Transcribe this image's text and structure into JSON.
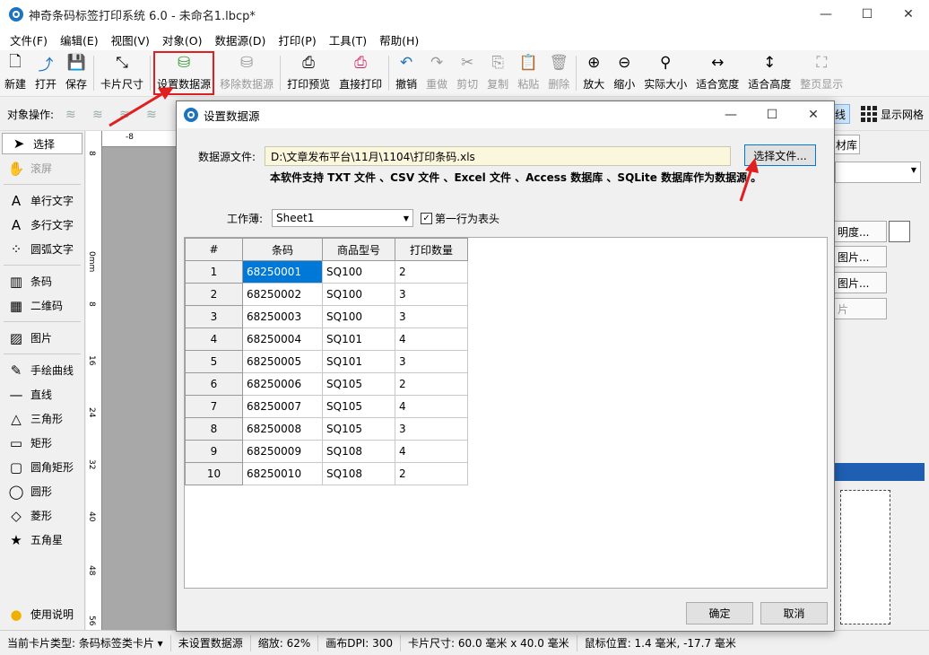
{
  "window": {
    "title": "神奇条码标签打印系统 6.0 - 未命名1.lbcp*",
    "controls": [
      "—",
      "☐",
      "✕"
    ]
  },
  "menu": [
    "文件(F)",
    "编辑(E)",
    "视图(V)",
    "对象(O)",
    "数据源(D)",
    "打印(P)",
    "工具(T)",
    "帮助(H)"
  ],
  "toolbar": [
    {
      "label": "新建",
      "icon": "new-file-icon",
      "glyph": "🗋"
    },
    {
      "label": "打开",
      "icon": "open-icon",
      "glyph": "⤴"
    },
    {
      "label": "保存",
      "icon": "save-icon",
      "glyph": "💾"
    },
    {
      "label": "卡片尺寸",
      "icon": "card-size-icon",
      "glyph": "⤡"
    },
    {
      "label": "设置数据源",
      "icon": "database-icon",
      "glyph": "⛁"
    },
    {
      "label": "移除数据源",
      "icon": "database-remove-icon",
      "glyph": "⛁"
    },
    {
      "label": "打印预览",
      "icon": "print-preview-icon",
      "glyph": "⎙"
    },
    {
      "label": "直接打印",
      "icon": "printer-icon",
      "glyph": "⎙"
    },
    {
      "label": "撤销",
      "icon": "undo-icon",
      "glyph": "↶"
    },
    {
      "label": "重做",
      "icon": "redo-icon",
      "glyph": "↷"
    },
    {
      "label": "剪切",
      "icon": "cut-icon",
      "glyph": "✂"
    },
    {
      "label": "复制",
      "icon": "copy-icon",
      "glyph": "⎘"
    },
    {
      "label": "粘贴",
      "icon": "paste-icon",
      "glyph": "📋"
    },
    {
      "label": "删除",
      "icon": "delete-icon",
      "glyph": "🗑"
    },
    {
      "label": "放大",
      "icon": "zoom-in-icon",
      "glyph": "⊕"
    },
    {
      "label": "缩小",
      "icon": "zoom-out-icon",
      "glyph": "⊖"
    },
    {
      "label": "实际大小",
      "icon": "actual-size-icon",
      "glyph": "⚲"
    },
    {
      "label": "适合宽度",
      "icon": "fit-width-icon",
      "glyph": "↔"
    },
    {
      "label": "适合高度",
      "icon": "fit-height-icon",
      "glyph": "↕"
    },
    {
      "label": "整页显示",
      "icon": "full-page-icon",
      "glyph": "⛶"
    }
  ],
  "objbar": {
    "label": "对象操作:",
    "line_toggle": "线",
    "grid_label": "显示网格"
  },
  "left_tools": [
    {
      "label": "选择",
      "icon": "cursor-icon",
      "glyph": "➤"
    },
    {
      "label": "滚屏",
      "icon": "hand-icon",
      "glyph": "✋"
    },
    {
      "label": "单行文字",
      "icon": "single-line-text-icon",
      "glyph": "A"
    },
    {
      "label": "多行文字",
      "icon": "multi-line-text-icon",
      "glyph": "A"
    },
    {
      "label": "圆弧文字",
      "icon": "arc-text-icon",
      "glyph": "⁘"
    },
    {
      "label": "条码",
      "icon": "barcode-icon",
      "glyph": "▥"
    },
    {
      "label": "二维码",
      "icon": "qrcode-icon",
      "glyph": "▦"
    },
    {
      "label": "图片",
      "icon": "image-icon",
      "glyph": "▨"
    },
    {
      "label": "手绘曲线",
      "icon": "pen-icon",
      "glyph": "✎"
    },
    {
      "label": "直线",
      "icon": "line-icon",
      "glyph": "—"
    },
    {
      "label": "三角形",
      "icon": "triangle-icon",
      "glyph": "△"
    },
    {
      "label": "矩形",
      "icon": "rectangle-icon",
      "glyph": "▭"
    },
    {
      "label": "圆角矩形",
      "icon": "rounded-rectangle-icon",
      "glyph": "▢"
    },
    {
      "label": "圆形",
      "icon": "circle-icon",
      "glyph": "◯"
    },
    {
      "label": "菱形",
      "icon": "diamond-icon",
      "glyph": "◇"
    },
    {
      "label": "五角星",
      "icon": "star-icon",
      "glyph": "★"
    }
  ],
  "help_label": "使用说明",
  "ruler": {
    "top": "-8",
    "left": [
      "8",
      "0mm",
      "8",
      "16",
      "24",
      "32",
      "40",
      "48",
      "56"
    ]
  },
  "right_panel": {
    "tab": "材库",
    "btn1": "明度...",
    "btn2": "图片...",
    "btn3": "图片...",
    "btn4": "片"
  },
  "status": {
    "card_type": "当前卡片类型: 条码标签类卡片 ▾",
    "datasource": "未设置数据源",
    "zoom": "缩放: 62%",
    "dpi": "画布DPI: 300",
    "size": "卡片尺寸: 60.0 毫米 x 40.0 毫米",
    "mouse": "鼠标位置: 1.4 毫米, -17.7 毫米"
  },
  "dialog": {
    "title": "设置数据源",
    "file_label": "数据源文件:",
    "file_path": "D:\\文章发布平台\\11月\\1104\\打印条码.xls",
    "choose_btn": "选择文件...",
    "support_note": "本软件支持 TXT 文件 、CSV 文件 、Excel 文件 、Access 数据库 、SQLite 数据库作为数据源 。",
    "sheet_label": "工作薄:",
    "sheet_value": "Sheet1",
    "header_check_label": "第一行为表头",
    "header_checked": true,
    "columns": [
      "#",
      "条码",
      "商品型号",
      "打印数量"
    ],
    "rows": [
      [
        "1",
        "68250001",
        "SQ100",
        "2"
      ],
      [
        "2",
        "68250002",
        "SQ100",
        "3"
      ],
      [
        "3",
        "68250003",
        "SQ100",
        "3"
      ],
      [
        "4",
        "68250004",
        "SQ101",
        "4"
      ],
      [
        "5",
        "68250005",
        "SQ101",
        "3"
      ],
      [
        "6",
        "68250006",
        "SQ105",
        "2"
      ],
      [
        "7",
        "68250007",
        "SQ105",
        "4"
      ],
      [
        "8",
        "68250008",
        "SQ105",
        "3"
      ],
      [
        "9",
        "68250009",
        "SQ108",
        "4"
      ],
      [
        "10",
        "68250010",
        "SQ108",
        "2"
      ]
    ],
    "ok": "确定",
    "cancel": "取消"
  },
  "colors": {
    "accent": "#0078d7",
    "annotation": "#e02020",
    "file_bg": "#fbf7dc"
  }
}
